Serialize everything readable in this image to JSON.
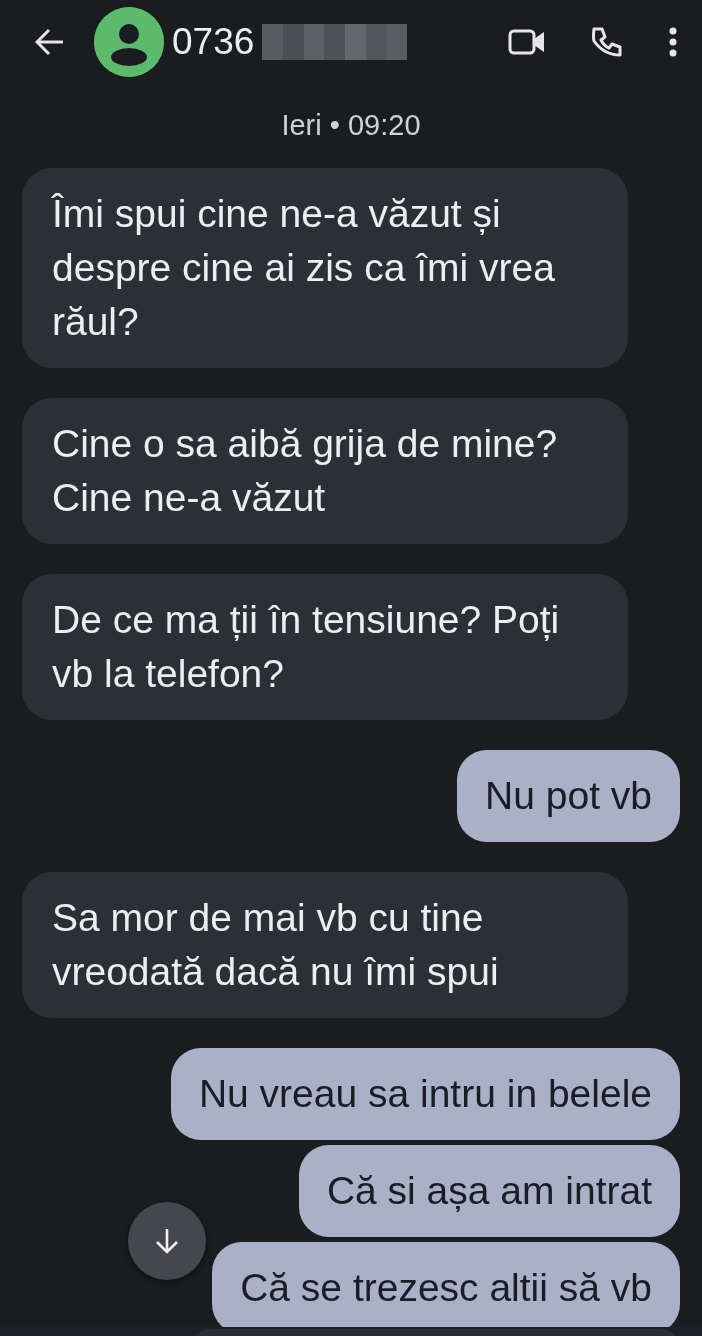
{
  "header": {
    "contact": "0736",
    "number_redacted": true
  },
  "timestamp": "Ieri • 09:20",
  "messages": [
    {
      "kind": "incoming",
      "text": "Îmi spui cine ne-a văzut și despre cine ai zis ca îmi vrea răul?"
    },
    {
      "kind": "incoming",
      "text": "Cine o sa aibă grija de mine? Cine ne-a văzut"
    },
    {
      "kind": "incoming",
      "text": "De ce ma ții în tensiune? Poți vb la telefon?"
    },
    {
      "kind": "outgoing",
      "text": "Nu pot vb"
    },
    {
      "kind": "incoming",
      "text": "Sa mor de mai vb cu tine vreodată dacă nu îmi spui"
    },
    {
      "kind": "outgoing",
      "text": "Nu vreau sa intru in belele"
    },
    {
      "kind": "outgoing",
      "text": "Că si așa am intrat"
    },
    {
      "kind": "outgoing",
      "text": "Că se trezesc altii să vb"
    }
  ]
}
